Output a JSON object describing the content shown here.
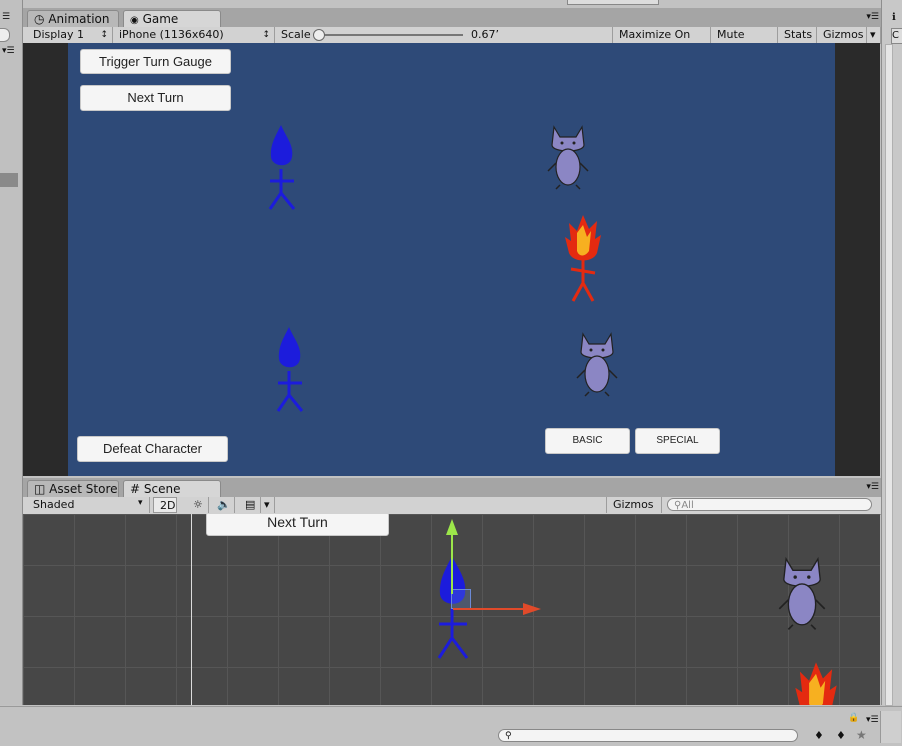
{
  "tabs_top": [
    {
      "label": "Animation",
      "icon": "clock-icon"
    },
    {
      "label": "Game",
      "icon": "game-controller-icon"
    }
  ],
  "game_toolbar": {
    "display": "Display 1",
    "resolution": "iPhone (1136x640)",
    "scale_label": "Scale",
    "scale_value": "0.67’",
    "maximize_on_play": "Maximize On Play",
    "mute_audio": "Mute Audio",
    "stats": "Stats",
    "gizmos": "Gizmos"
  },
  "game_view": {
    "trigger_turn_gauge": "Trigger Turn Gauge",
    "next_turn": "Next Turn",
    "defeat_character": "Defeat Character",
    "basic": "BASIC",
    "special": "SPECIAL"
  },
  "tabs_bottom": [
    {
      "label": "Asset Store",
      "icon": "bag-icon"
    },
    {
      "label": "Scene",
      "icon": "grid-hash-icon"
    }
  ],
  "scene_toolbar": {
    "shading": "Shaded",
    "mode_2d": "2D",
    "gizmos": "Gizmos",
    "search_placeholder": "All"
  },
  "scene_view": {
    "next_turn": "Next Turn"
  },
  "colors": {
    "game_bg": "#2e4a78",
    "scene_bg": "#474747",
    "player": "#1c1cdc",
    "fire": "#e42a10",
    "cat": "#8b86c4"
  }
}
